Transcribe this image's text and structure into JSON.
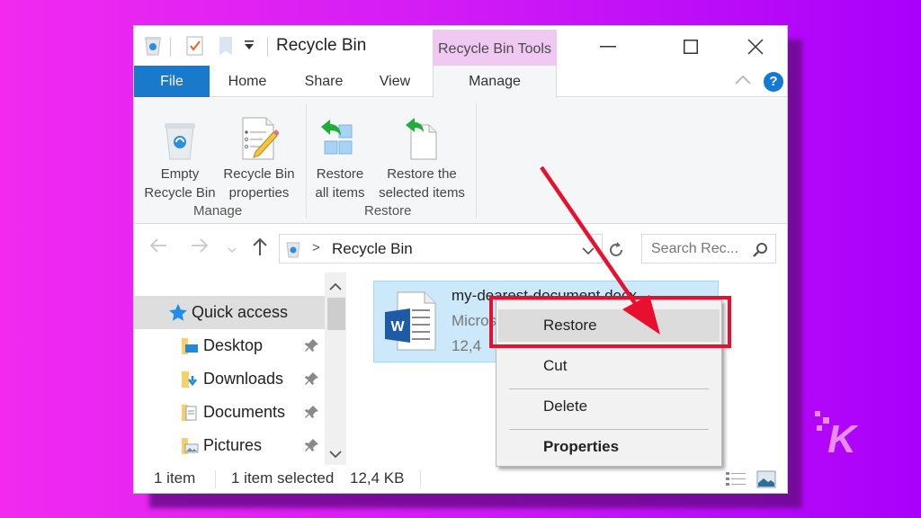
{
  "window": {
    "title": "Recycle Bin",
    "context_tab_group": "Recycle Bin Tools",
    "controls": {
      "minimize": "minimize",
      "maximize": "maximize",
      "close": "close"
    }
  },
  "tabs": [
    {
      "label": "File"
    },
    {
      "label": "Home"
    },
    {
      "label": "Share"
    },
    {
      "label": "View"
    },
    {
      "label": "Manage",
      "active": true
    }
  ],
  "help_label": "?",
  "ribbon": {
    "groups": [
      {
        "label": "Manage",
        "buttons": [
          {
            "line1": "Empty",
            "line2": "Recycle Bin",
            "icon": "recycle-bin-icon"
          },
          {
            "line1": "Recycle Bin",
            "line2": "properties",
            "icon": "properties-icon"
          }
        ]
      },
      {
        "label": "Restore",
        "buttons": [
          {
            "line1": "Restore",
            "line2": "all items",
            "icon": "restore-all-icon"
          },
          {
            "line1": "Restore the",
            "line2": "selected items",
            "icon": "restore-selected-icon"
          }
        ]
      }
    ]
  },
  "address_bar": {
    "path": "Recycle Bin",
    "separator": ">"
  },
  "search": {
    "placeholder": "Search Rec..."
  },
  "sidebar": {
    "items": [
      {
        "label": "Quick access",
        "icon": "star-icon",
        "active": true
      },
      {
        "label": "Desktop",
        "icon": "desktop-folder-icon",
        "pinned": true
      },
      {
        "label": "Downloads",
        "icon": "downloads-folder-icon",
        "pinned": true
      },
      {
        "label": "Documents",
        "icon": "documents-folder-icon",
        "pinned": true
      },
      {
        "label": "Pictures",
        "icon": "pictures-folder-icon",
        "pinned": true
      }
    ]
  },
  "file": {
    "name": "my-dearest-document.docx",
    "type": "Micros",
    "size": "12,4"
  },
  "context_menu": {
    "items": [
      {
        "label": "Restore",
        "highlighted": true
      },
      {
        "label": "Cut"
      },
      {
        "label": "Delete"
      },
      {
        "label": "Properties",
        "bold": true
      }
    ]
  },
  "status_bar": {
    "count": "1 item",
    "selected": "1 item selected",
    "size": "12,4 KB"
  },
  "colors": {
    "accent": "#1979ca",
    "context_tab": "#f0c9f3",
    "selection": "#cce8fb",
    "annotation": "#e8102e",
    "background_left": "#f22af0",
    "background_right": "#a900fb"
  },
  "watermark": "K"
}
